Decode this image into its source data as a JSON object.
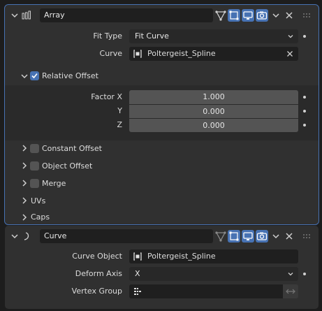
{
  "array_mod": {
    "name": "Array",
    "fit_type_label": "Fit Type",
    "fit_type_value": "Fit Curve",
    "curve_label": "Curve",
    "curve_value": "Poltergeist_Spline",
    "relative_offset": {
      "label": "Relative Offset",
      "checked": true,
      "factor_x_label": "Factor X",
      "factor_x": "1.000",
      "y_label": "Y",
      "y": "0.000",
      "z_label": "Z",
      "z": "0.000"
    },
    "sections": [
      {
        "label": "Constant Offset",
        "has_checkbox": true
      },
      {
        "label": "Object Offset",
        "has_checkbox": true
      },
      {
        "label": "Merge",
        "has_checkbox": true
      },
      {
        "label": "UVs",
        "has_checkbox": false
      },
      {
        "label": "Caps",
        "has_checkbox": false
      }
    ]
  },
  "curve_mod": {
    "name": "Curve",
    "curve_object_label": "Curve Object",
    "curve_object_value": "Poltergeist_Spline",
    "deform_axis_label": "Deform Axis",
    "deform_axis_value": "X",
    "vertex_group_label": "Vertex Group",
    "vertex_group_value": ""
  },
  "colors": {
    "accent": "#4772b3",
    "panel": "#303030",
    "background": "#1d1d1d"
  }
}
